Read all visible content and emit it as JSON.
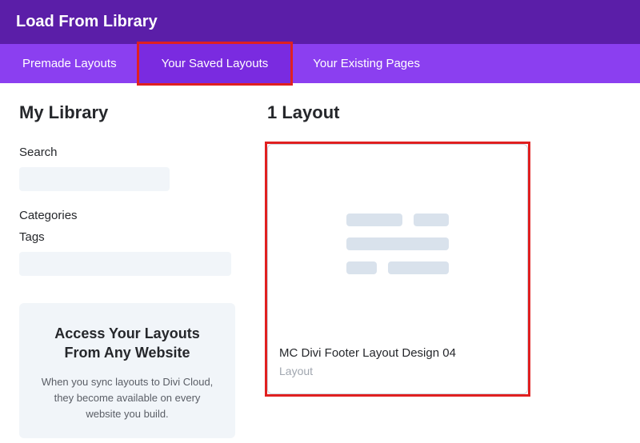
{
  "header": {
    "title": "Load From Library"
  },
  "tabs": [
    {
      "label": "Premade Layouts",
      "active": false
    },
    {
      "label": "Your Saved Layouts",
      "active": true
    },
    {
      "label": "Your Existing Pages",
      "active": false
    }
  ],
  "sidebar": {
    "title": "My Library",
    "search_label": "Search",
    "search_value": "",
    "categories_label": "Categories",
    "tags_label": "Tags",
    "tags_value": "",
    "promo": {
      "heading": "Access Your Layouts From Any Website",
      "body": "When you sync layouts to Divi Cloud, they become available on every website you build."
    }
  },
  "content": {
    "count_label": "1 Layout",
    "cards": [
      {
        "title": "MC Divi Footer Layout Design 04",
        "subtitle": "Layout"
      }
    ]
  }
}
